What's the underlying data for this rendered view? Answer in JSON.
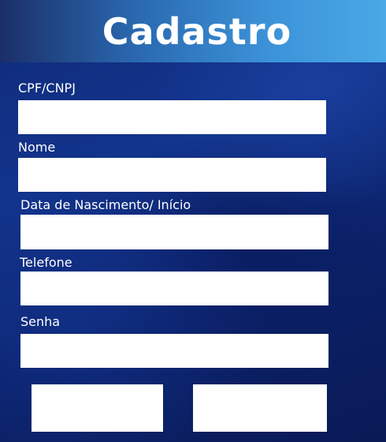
{
  "header": {
    "title": "Cadastro"
  },
  "form": {
    "cpf_cnpj": {
      "label": "CPF/CNPJ",
      "value": ""
    },
    "nome": {
      "label": "Nome",
      "value": ""
    },
    "data_nascimento": {
      "label": "Data de Nascimento/ Início",
      "value": ""
    },
    "telefone": {
      "label": "Telefone",
      "value": ""
    },
    "senha": {
      "label": "Senha",
      "value": ""
    }
  },
  "actions": {
    "left_button_label": "",
    "right_button_label": ""
  },
  "colors": {
    "header_start": "#1b2f68",
    "header_end": "#4aa8e6",
    "background": "#0f2a7a",
    "field": "#ffffff"
  }
}
